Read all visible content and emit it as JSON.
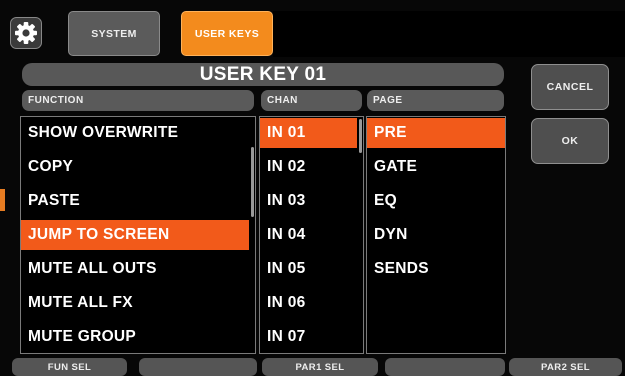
{
  "tabs": {
    "system_label": "SYSTEM",
    "user_keys_label": "USER KEYS"
  },
  "title": "USER KEY 01",
  "headers": {
    "function": "FUNCTION",
    "chan": "CHAN",
    "page": "PAGE"
  },
  "function_list": {
    "items": [
      "SHOW OVERWRITE",
      "COPY",
      "PASTE",
      "JUMP TO SCREEN",
      "MUTE ALL OUTS",
      "MUTE ALL FX",
      "MUTE GROUP"
    ],
    "selected": "JUMP TO SCREEN"
  },
  "chan_list": {
    "items": [
      "IN 01",
      "IN 02",
      "IN 03",
      "IN 04",
      "IN 05",
      "IN 06",
      "IN 07"
    ],
    "selected": "IN 01"
  },
  "page_list": {
    "items": [
      "PRE",
      "GATE",
      "EQ",
      "DYN",
      "SENDS"
    ],
    "selected": "PRE"
  },
  "buttons": {
    "cancel": "CANCEL",
    "ok": "OK"
  },
  "softkeys": [
    "FUN SEL",
    "",
    "PAR1 SEL",
    "",
    "PAR2 SEL"
  ],
  "colors": {
    "accent_orange": "#f38b1d",
    "selection": "#f25a1a",
    "panel_gray": "#585858"
  }
}
